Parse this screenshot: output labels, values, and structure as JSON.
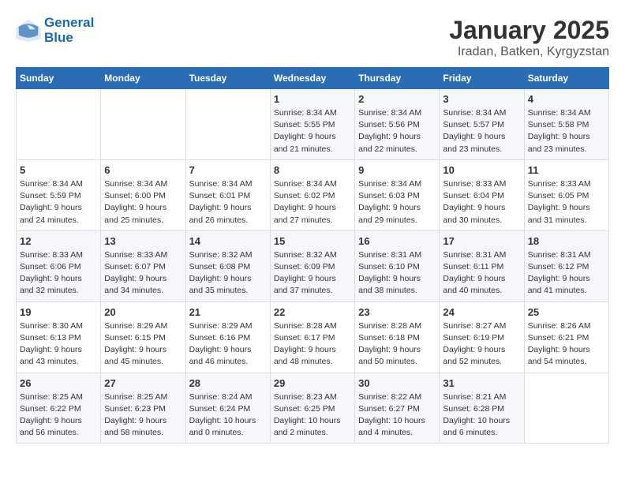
{
  "logo": {
    "line1": "General",
    "line2": "Blue"
  },
  "title": "January 2025",
  "subtitle": "Iradan, Batken, Kyrgyzstan",
  "weekdays": [
    "Sunday",
    "Monday",
    "Tuesday",
    "Wednesday",
    "Thursday",
    "Friday",
    "Saturday"
  ],
  "weeks": [
    [
      {
        "day": "",
        "sunrise": "",
        "sunset": "",
        "daylight": ""
      },
      {
        "day": "",
        "sunrise": "",
        "sunset": "",
        "daylight": ""
      },
      {
        "day": "",
        "sunrise": "",
        "sunset": "",
        "daylight": ""
      },
      {
        "day": "1",
        "sunrise": "Sunrise: 8:34 AM",
        "sunset": "Sunset: 5:55 PM",
        "daylight": "Daylight: 9 hours and 21 minutes."
      },
      {
        "day": "2",
        "sunrise": "Sunrise: 8:34 AM",
        "sunset": "Sunset: 5:56 PM",
        "daylight": "Daylight: 9 hours and 22 minutes."
      },
      {
        "day": "3",
        "sunrise": "Sunrise: 8:34 AM",
        "sunset": "Sunset: 5:57 PM",
        "daylight": "Daylight: 9 hours and 23 minutes."
      },
      {
        "day": "4",
        "sunrise": "Sunrise: 8:34 AM",
        "sunset": "Sunset: 5:58 PM",
        "daylight": "Daylight: 9 hours and 23 minutes."
      }
    ],
    [
      {
        "day": "5",
        "sunrise": "Sunrise: 8:34 AM",
        "sunset": "Sunset: 5:59 PM",
        "daylight": "Daylight: 9 hours and 24 minutes."
      },
      {
        "day": "6",
        "sunrise": "Sunrise: 8:34 AM",
        "sunset": "Sunset: 6:00 PM",
        "daylight": "Daylight: 9 hours and 25 minutes."
      },
      {
        "day": "7",
        "sunrise": "Sunrise: 8:34 AM",
        "sunset": "Sunset: 6:01 PM",
        "daylight": "Daylight: 9 hours and 26 minutes."
      },
      {
        "day": "8",
        "sunrise": "Sunrise: 8:34 AM",
        "sunset": "Sunset: 6:02 PM",
        "daylight": "Daylight: 9 hours and 27 minutes."
      },
      {
        "day": "9",
        "sunrise": "Sunrise: 8:34 AM",
        "sunset": "Sunset: 6:03 PM",
        "daylight": "Daylight: 9 hours and 29 minutes."
      },
      {
        "day": "10",
        "sunrise": "Sunrise: 8:33 AM",
        "sunset": "Sunset: 6:04 PM",
        "daylight": "Daylight: 9 hours and 30 minutes."
      },
      {
        "day": "11",
        "sunrise": "Sunrise: 8:33 AM",
        "sunset": "Sunset: 6:05 PM",
        "daylight": "Daylight: 9 hours and 31 minutes."
      }
    ],
    [
      {
        "day": "12",
        "sunrise": "Sunrise: 8:33 AM",
        "sunset": "Sunset: 6:06 PM",
        "daylight": "Daylight: 9 hours and 32 minutes."
      },
      {
        "day": "13",
        "sunrise": "Sunrise: 8:33 AM",
        "sunset": "Sunset: 6:07 PM",
        "daylight": "Daylight: 9 hours and 34 minutes."
      },
      {
        "day": "14",
        "sunrise": "Sunrise: 8:32 AM",
        "sunset": "Sunset: 6:08 PM",
        "daylight": "Daylight: 9 hours and 35 minutes."
      },
      {
        "day": "15",
        "sunrise": "Sunrise: 8:32 AM",
        "sunset": "Sunset: 6:09 PM",
        "daylight": "Daylight: 9 hours and 37 minutes."
      },
      {
        "day": "16",
        "sunrise": "Sunrise: 8:31 AM",
        "sunset": "Sunset: 6:10 PM",
        "daylight": "Daylight: 9 hours and 38 minutes."
      },
      {
        "day": "17",
        "sunrise": "Sunrise: 8:31 AM",
        "sunset": "Sunset: 6:11 PM",
        "daylight": "Daylight: 9 hours and 40 minutes."
      },
      {
        "day": "18",
        "sunrise": "Sunrise: 8:31 AM",
        "sunset": "Sunset: 6:12 PM",
        "daylight": "Daylight: 9 hours and 41 minutes."
      }
    ],
    [
      {
        "day": "19",
        "sunrise": "Sunrise: 8:30 AM",
        "sunset": "Sunset: 6:13 PM",
        "daylight": "Daylight: 9 hours and 43 minutes."
      },
      {
        "day": "20",
        "sunrise": "Sunrise: 8:29 AM",
        "sunset": "Sunset: 6:15 PM",
        "daylight": "Daylight: 9 hours and 45 minutes."
      },
      {
        "day": "21",
        "sunrise": "Sunrise: 8:29 AM",
        "sunset": "Sunset: 6:16 PM",
        "daylight": "Daylight: 9 hours and 46 minutes."
      },
      {
        "day": "22",
        "sunrise": "Sunrise: 8:28 AM",
        "sunset": "Sunset: 6:17 PM",
        "daylight": "Daylight: 9 hours and 48 minutes."
      },
      {
        "day": "23",
        "sunrise": "Sunrise: 8:28 AM",
        "sunset": "Sunset: 6:18 PM",
        "daylight": "Daylight: 9 hours and 50 minutes."
      },
      {
        "day": "24",
        "sunrise": "Sunrise: 8:27 AM",
        "sunset": "Sunset: 6:19 PM",
        "daylight": "Daylight: 9 hours and 52 minutes."
      },
      {
        "day": "25",
        "sunrise": "Sunrise: 8:26 AM",
        "sunset": "Sunset: 6:21 PM",
        "daylight": "Daylight: 9 hours and 54 minutes."
      }
    ],
    [
      {
        "day": "26",
        "sunrise": "Sunrise: 8:25 AM",
        "sunset": "Sunset: 6:22 PM",
        "daylight": "Daylight: 9 hours and 56 minutes."
      },
      {
        "day": "27",
        "sunrise": "Sunrise: 8:25 AM",
        "sunset": "Sunset: 6:23 PM",
        "daylight": "Daylight: 9 hours and 58 minutes."
      },
      {
        "day": "28",
        "sunrise": "Sunrise: 8:24 AM",
        "sunset": "Sunset: 6:24 PM",
        "daylight": "Daylight: 10 hours and 0 minutes."
      },
      {
        "day": "29",
        "sunrise": "Sunrise: 8:23 AM",
        "sunset": "Sunset: 6:25 PM",
        "daylight": "Daylight: 10 hours and 2 minutes."
      },
      {
        "day": "30",
        "sunrise": "Sunrise: 8:22 AM",
        "sunset": "Sunset: 6:27 PM",
        "daylight": "Daylight: 10 hours and 4 minutes."
      },
      {
        "day": "31",
        "sunrise": "Sunrise: 8:21 AM",
        "sunset": "Sunset: 6:28 PM",
        "daylight": "Daylight: 10 hours and 6 minutes."
      },
      {
        "day": "",
        "sunrise": "",
        "sunset": "",
        "daylight": ""
      }
    ]
  ]
}
